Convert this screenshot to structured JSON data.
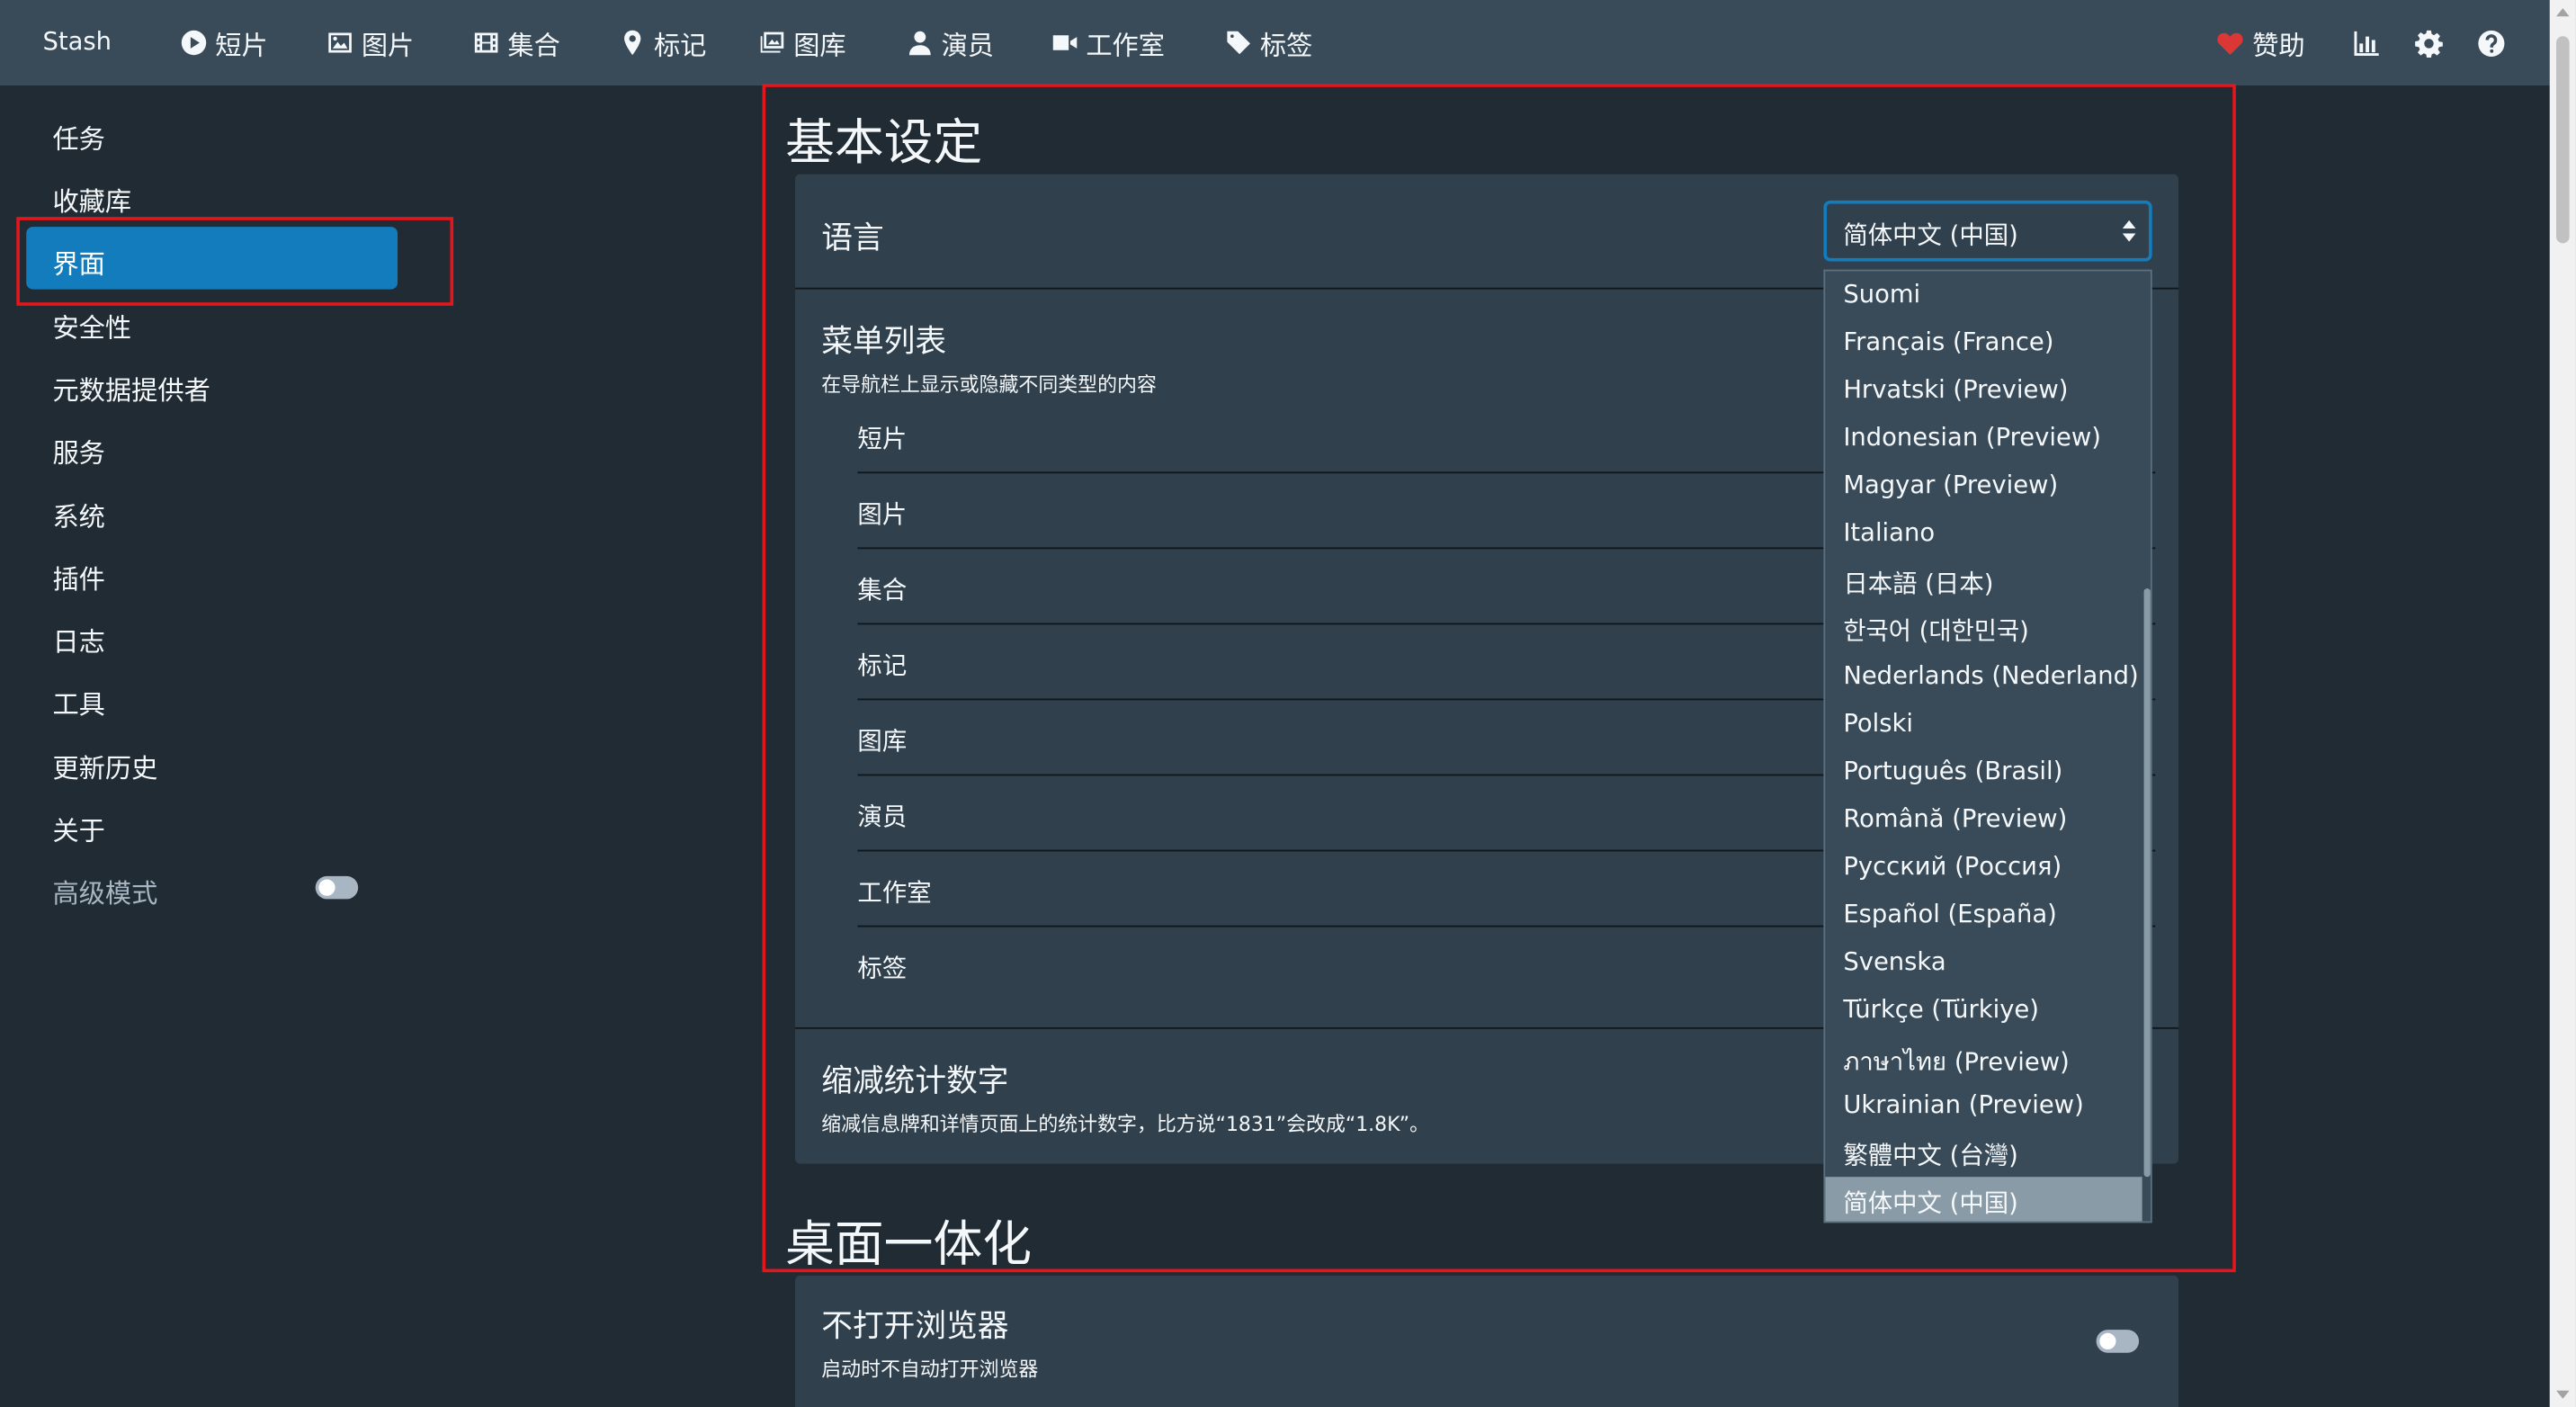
{
  "navbar": {
    "brand": "Stash",
    "items": [
      {
        "label": "短片",
        "icon": "play-circle-icon"
      },
      {
        "label": "图片",
        "icon": "image-icon"
      },
      {
        "label": "集合",
        "icon": "film-icon"
      },
      {
        "label": "标记",
        "icon": "map-marker-icon"
      },
      {
        "label": "图库",
        "icon": "images-icon"
      },
      {
        "label": "演员",
        "icon": "user-icon"
      },
      {
        "label": "工作室",
        "icon": "video-camera-icon"
      },
      {
        "label": "标签",
        "icon": "tag-icon"
      }
    ],
    "donate_label": "赞助",
    "icons": [
      "heart-icon",
      "chart-icon",
      "gear-icon",
      "help-icon"
    ]
  },
  "sidebar": {
    "items": [
      "任务",
      "收藏库",
      "界面",
      "安全性",
      "元数据提供者",
      "服务",
      "系统",
      "插件",
      "日志",
      "工具",
      "更新历史",
      "关于"
    ],
    "active_index": 2,
    "advanced_mode_label": "高级模式",
    "advanced_mode_on": false
  },
  "basic_settings": {
    "heading": "基本设定",
    "language": {
      "label": "语言",
      "selected": "简体中文 (中国)",
      "options": [
        "Suomi",
        "Français (France)",
        "Hrvatski (Preview)",
        "Indonesian (Preview)",
        "Magyar (Preview)",
        "Italiano",
        "日本語 (日本)",
        "한국어 (대한민국)",
        "Nederlands (Nederland)",
        "Polski",
        "Português (Brasil)",
        "Română (Preview)",
        "Русский (Россия)",
        "Español (España)",
        "Svenska",
        "Türkçe (Türkiye)",
        "ภาษาไทย (Preview)",
        "Ukrainian (Preview)",
        "繁體中文 (台灣)",
        "简体中文 (中国)"
      ]
    },
    "menu_list": {
      "title": "菜单列表",
      "subtitle": "在导航栏上显示或隐藏不同类型的内容",
      "items": [
        "短片",
        "图片",
        "集合",
        "标记",
        "图库",
        "演员",
        "工作室",
        "标签"
      ]
    },
    "abbreviate": {
      "title": "缩减统计数字",
      "subtitle": "缩减信息牌和详情页面上的统计数字，比方说“1831”会改成“1.8K”。"
    }
  },
  "desktop_integration": {
    "heading": "桌面一体化",
    "no_browser": {
      "title": "不打开浏览器",
      "subtitle": "启动时不自动打开浏览器",
      "enabled": false
    }
  },
  "colors": {
    "background": "#202b33",
    "navbar": "#394b59",
    "card": "#30404d",
    "accent": "#137cbd",
    "highlight_box": "#e3161d"
  }
}
